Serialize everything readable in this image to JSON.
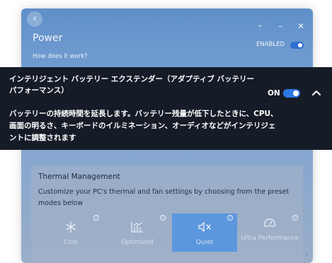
{
  "window": {
    "title": "Power",
    "link": "How does it work?",
    "enabled_label": "ENABLED",
    "enabled_on": true,
    "controls": [
      "chevron-down-icon",
      "minimize-icon",
      "close-icon"
    ]
  },
  "extender": {
    "title": "インテリジェント バッテリー エクステンダー（アダプティブ バッテリー パフォーマンス）",
    "state_label": "ON",
    "state_on": true,
    "description": "バッテリーの持続時間を延長します。バッテリー残量が低下したときに、CPU、画面の明るさ、キーボードのイルミネーション、オーディオなどがインテリジェントに調整されます",
    "expanded": true
  },
  "thermal": {
    "title": "Thermal Management",
    "description": "Customize your PC's thermal and fan settings by choosing from the preset modes below",
    "modes": [
      {
        "label": "Cool",
        "icon": "snowflake-icon",
        "selected": false
      },
      {
        "label": "Optimized",
        "icon": "chart-icon",
        "selected": false
      },
      {
        "label": "Quiet",
        "icon": "speaker-mute-icon",
        "selected": true
      },
      {
        "label": "Ultra Performance",
        "icon": "speedometer-icon",
        "selected": false
      }
    ]
  },
  "colors": {
    "overlay_bg": "#161c27",
    "toggle_on": "#2f79e6",
    "selected_mode": "#5c97dd"
  }
}
